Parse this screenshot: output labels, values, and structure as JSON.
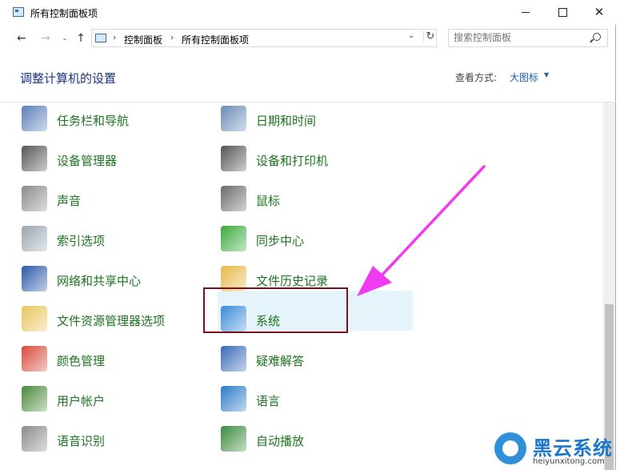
{
  "window": {
    "title": "所有控制面板项",
    "controls": {
      "minimize": "—",
      "maximize": "□",
      "close": "✕"
    }
  },
  "nav": {
    "back": "←",
    "forward": "→",
    "recent": "⌄",
    "up": "↑",
    "breadcrumb": [
      "控制面板",
      "所有控制面板项"
    ],
    "breadcrumb_sep": "›",
    "dropdown": "⌄",
    "refresh": "↻"
  },
  "search": {
    "placeholder": "搜索控制面板"
  },
  "header": {
    "title": "调整计算机的设置",
    "view_label": "查看方式:",
    "view_value": "大图标",
    "view_arrow": "▼"
  },
  "items_left": [
    {
      "label": "任务栏和导航",
      "icon": "taskbar-icon",
      "color": "#5b7fb8"
    },
    {
      "label": "设备管理器",
      "icon": "device-manager-icon",
      "color": "#555555"
    },
    {
      "label": "声音",
      "icon": "sound-icon",
      "color": "#8a8a8a"
    },
    {
      "label": "索引选项",
      "icon": "indexing-icon",
      "color": "#9aa6b2"
    },
    {
      "label": "网络和共享中心",
      "icon": "network-icon",
      "color": "#2a5aa8"
    },
    {
      "label": "文件资源管理器选项",
      "icon": "folder-options-icon",
      "color": "#e8c55a"
    },
    {
      "label": "颜色管理",
      "icon": "color-management-icon",
      "color": "#d84a3a"
    },
    {
      "label": "用户帐户",
      "icon": "user-accounts-icon",
      "color": "#4a8a3a"
    },
    {
      "label": "语音识别",
      "icon": "speech-recognition-icon",
      "color": "#8a8a8a"
    }
  ],
  "items_right": [
    {
      "label": "日期和时间",
      "icon": "date-time-icon",
      "color": "#6a8ab8"
    },
    {
      "label": "设备和打印机",
      "icon": "devices-printers-icon",
      "color": "#555555"
    },
    {
      "label": "鼠标",
      "icon": "mouse-icon",
      "color": "#6a6a6a"
    },
    {
      "label": "同步中心",
      "icon": "sync-center-icon",
      "color": "#3aa83a"
    },
    {
      "label": "文件历史记录",
      "icon": "file-history-icon",
      "color": "#e8b84a"
    },
    {
      "label": "系统",
      "icon": "system-icon",
      "color": "#3a8ad8"
    },
    {
      "label": "疑难解答",
      "icon": "troubleshooting-icon",
      "color": "#3a6ab8"
    },
    {
      "label": "语言",
      "icon": "language-icon",
      "color": "#2a7ac8"
    },
    {
      "label": "自动播放",
      "icon": "autoplay-icon",
      "color": "#3a8a3a"
    }
  ],
  "annotation": {
    "arrow_color": "#f03cf0",
    "box_color": "#7a1116"
  },
  "watermark": {
    "name": "黑云系统",
    "url": "heiyunxitong.com",
    "color": "#1b76cc"
  }
}
